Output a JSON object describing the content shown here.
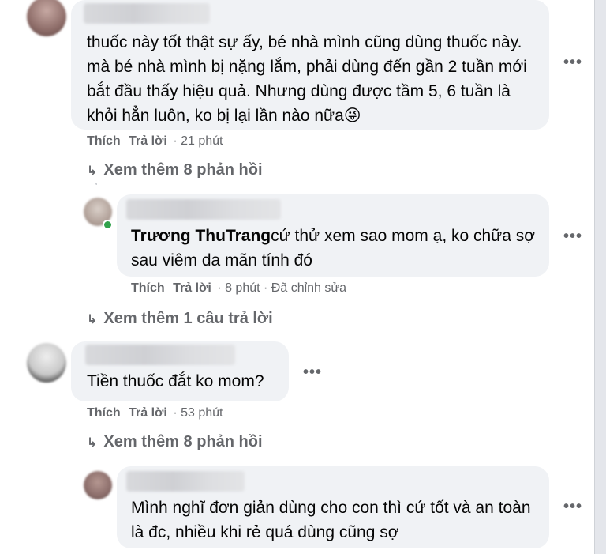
{
  "comments": [
    {
      "text": "thuốc này tốt thật sự ấy, bé nhà mình cũng dùng thuốc này. mà bé nhà mình bị nặng lắm, phải dùng đến gần 2 tuần mới bắt đầu thấy hiệu quả. Nhưng dùng được tầm 5, 6 tuần là khỏi hẳn luôn, ko bị lại lần nào nữa😜",
      "like": "Thích",
      "reply": "Trả lời",
      "time": "· 21 phút",
      "view_replies": "Xem thêm 8 phản hồi"
    },
    {
      "mention": "Trương ThuTrang",
      "text": "cứ thử xem sao mom ạ, ko chữa sợ sau viêm da mãn tính đó",
      "like": "Thích",
      "reply": "Trả lời",
      "time": "· 8 phút · Đã chỉnh sửa",
      "view_replies": "Xem thêm 1 câu trả lời"
    },
    {
      "text": "Tiền thuốc đắt ko mom?",
      "like": "Thích",
      "reply": "Trả lời",
      "time": "· 53 phút",
      "view_replies": "Xem thêm 8 phản hồi"
    },
    {
      "text": "Mình nghĩ đơn giản dùng cho con thì cứ tốt và an toàn là đc, nhiều khi rẻ quá dùng cũng sợ"
    }
  ],
  "icons": {
    "more": "more-horizontal-icon",
    "reply_arrow": "reply-arrow-icon"
  },
  "colors": {
    "bubble": "#f0f2f5",
    "secondary_text": "#65676b",
    "online": "#31a24c"
  }
}
